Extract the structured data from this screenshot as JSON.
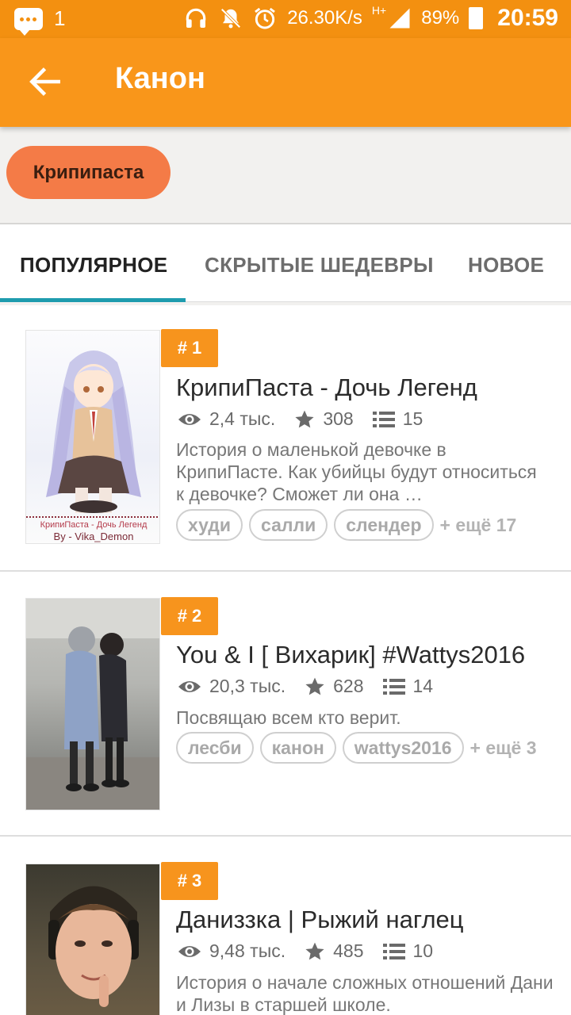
{
  "status_bar": {
    "notification_count": "1",
    "network_speed": "26.30K/s",
    "network_type": "H+",
    "battery": "89%",
    "time": "20:59"
  },
  "app_bar": {
    "title": "Канон",
    "back_icon": "arrow-left-icon"
  },
  "filter_chip": {
    "label": "Крипипаста"
  },
  "tabs": [
    {
      "label": "ПОПУЛЯРНОЕ",
      "active": true
    },
    {
      "label": "СКРЫТЫЕ ШЕДЕВРЫ",
      "active": false
    },
    {
      "label": "НОВОЕ",
      "active": false
    }
  ],
  "stories": [
    {
      "rank": "# 1",
      "title": "КрипиПаста - Дочь Легенд",
      "views": "2,4 тыс.",
      "votes": "308",
      "parts": "15",
      "description": "История о маленькой девочке в КрипиПасте. Как убийцы будут относиться к девочке? Сможет ли она …",
      "tags": [
        "худи",
        "салли",
        "слендер"
      ],
      "more_tags": "+ ещё 17",
      "cover_caption": "КрипиПаста - Дочь Легенд",
      "cover_author": "By - Vika_Demon"
    },
    {
      "rank": "# 2",
      "title": "You & I [ Вихарик] #Wattys2016",
      "views": "20,3 тыс.",
      "votes": "628",
      "parts": "14",
      "description": "Посвящаю всем кто верит.",
      "tags": [
        "лесби",
        "канон",
        "wattys2016"
      ],
      "more_tags": "+ ещё 3"
    },
    {
      "rank": "# 3",
      "title": "Даниззка | Рыжий наглец",
      "views": "9,48 тыс.",
      "votes": "485",
      "parts": "10",
      "description": "История о начале сложных отношений Дани и Лизы в старшей школе."
    }
  ],
  "colors": {
    "status_bar": "#f39010",
    "app_bar": "#f9961a",
    "chip": "#f47b47",
    "rank_badge": "#f7941d",
    "tab_indicator": "#1e9cae"
  }
}
